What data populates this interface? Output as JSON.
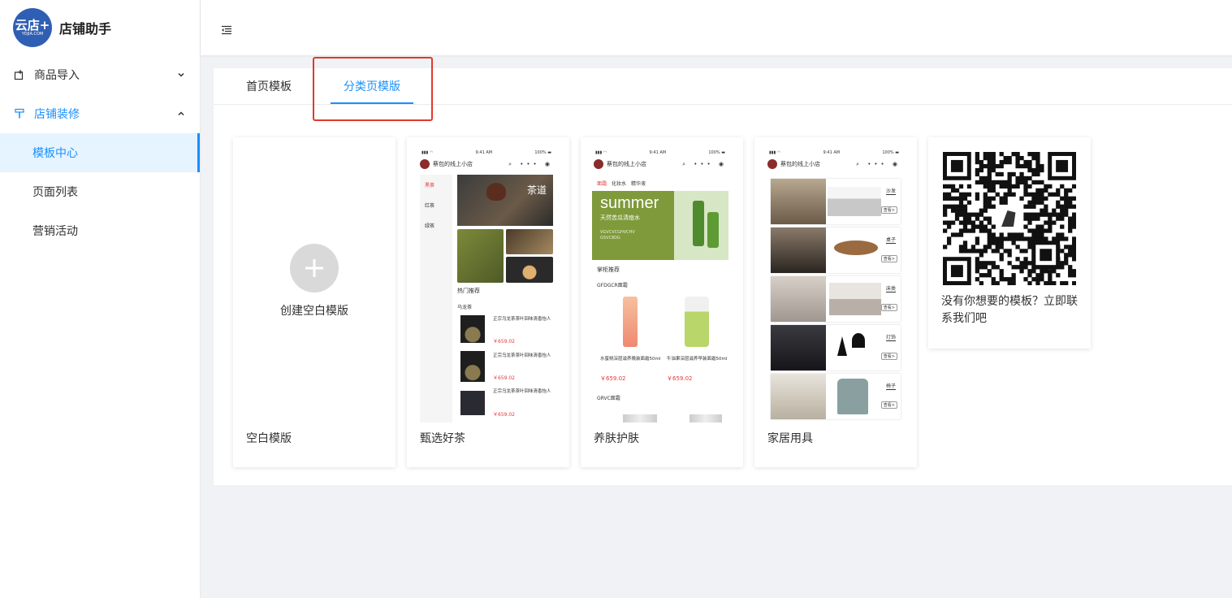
{
  "app": {
    "logo_text": "云店+",
    "logo_sub": "YDJIA.COM",
    "name": "店铺助手"
  },
  "sidebar": {
    "menus": [
      {
        "label": "商品导入",
        "expanded": false
      },
      {
        "label": "店铺装修",
        "expanded": true,
        "children": [
          {
            "label": "模板中心",
            "active": true
          },
          {
            "label": "页面列表"
          },
          {
            "label": "营销活动"
          }
        ]
      }
    ]
  },
  "tabs": [
    {
      "label": "首页模板",
      "active": false
    },
    {
      "label": "分类页模版",
      "active": true
    }
  ],
  "templates": {
    "blank": {
      "create_label": "创建空白模版",
      "name": "空白模版"
    },
    "tea": {
      "name": "甄选好茶",
      "status": {
        "time": "9:41 AM",
        "battery": "100%"
      },
      "shop": "蔡包的线上小店",
      "categories": [
        "黑茶",
        "红茶",
        "绿茶"
      ],
      "banner_text": "茶道",
      "section_hot": "热门推荐",
      "section_sub": "乌龙茶",
      "products": [
        {
          "title": "正宗乌龙茶茶叶回味清香怡人",
          "price": "￥659.02"
        },
        {
          "title": "正宗乌龙茶茶叶回味清香怡人",
          "price": "￥659.02"
        },
        {
          "title": "正宗乌龙茶茶叶回味清香怡人",
          "price": "￥659.02"
        }
      ]
    },
    "skincare": {
      "name": "养肤护肤",
      "status": {
        "time": "9:41 AM",
        "battery": "100%"
      },
      "shop": "蔡包的线上小店",
      "tabs": [
        "面霜",
        "化妆水",
        "精华液"
      ],
      "banner_title": "summer",
      "banner_sub": "天然苦瓜清痘水",
      "banner_code1": "VGVCVCGHVCHV",
      "banner_code2": "GSVC8DG",
      "section1": "掌柜推荐",
      "section2": "GFDGCR面霜",
      "products": [
        {
          "title": "水蜜桃深层滋养晚装面霜50ml",
          "price": "￥659.02"
        },
        {
          "title": "牛油果深层滋养早装面霜50ml",
          "price": "￥659.02"
        }
      ],
      "section3": "GRVC面霜"
    },
    "home": {
      "name": "家居用具",
      "status": {
        "time": "9:41 AM",
        "battery": "100%"
      },
      "shop": "蔡包的线上小店",
      "rows": [
        {
          "label": "沙发",
          "btn": "查看>"
        },
        {
          "label": "桌子",
          "btn": "查看>"
        },
        {
          "label": "床类",
          "btn": "查看>"
        },
        {
          "label": "灯饰",
          "btn": "查看>"
        },
        {
          "label": "椅子",
          "btn": "查看>"
        }
      ]
    }
  },
  "contact": {
    "text": "没有你想要的模板？立即联系我们吧"
  }
}
